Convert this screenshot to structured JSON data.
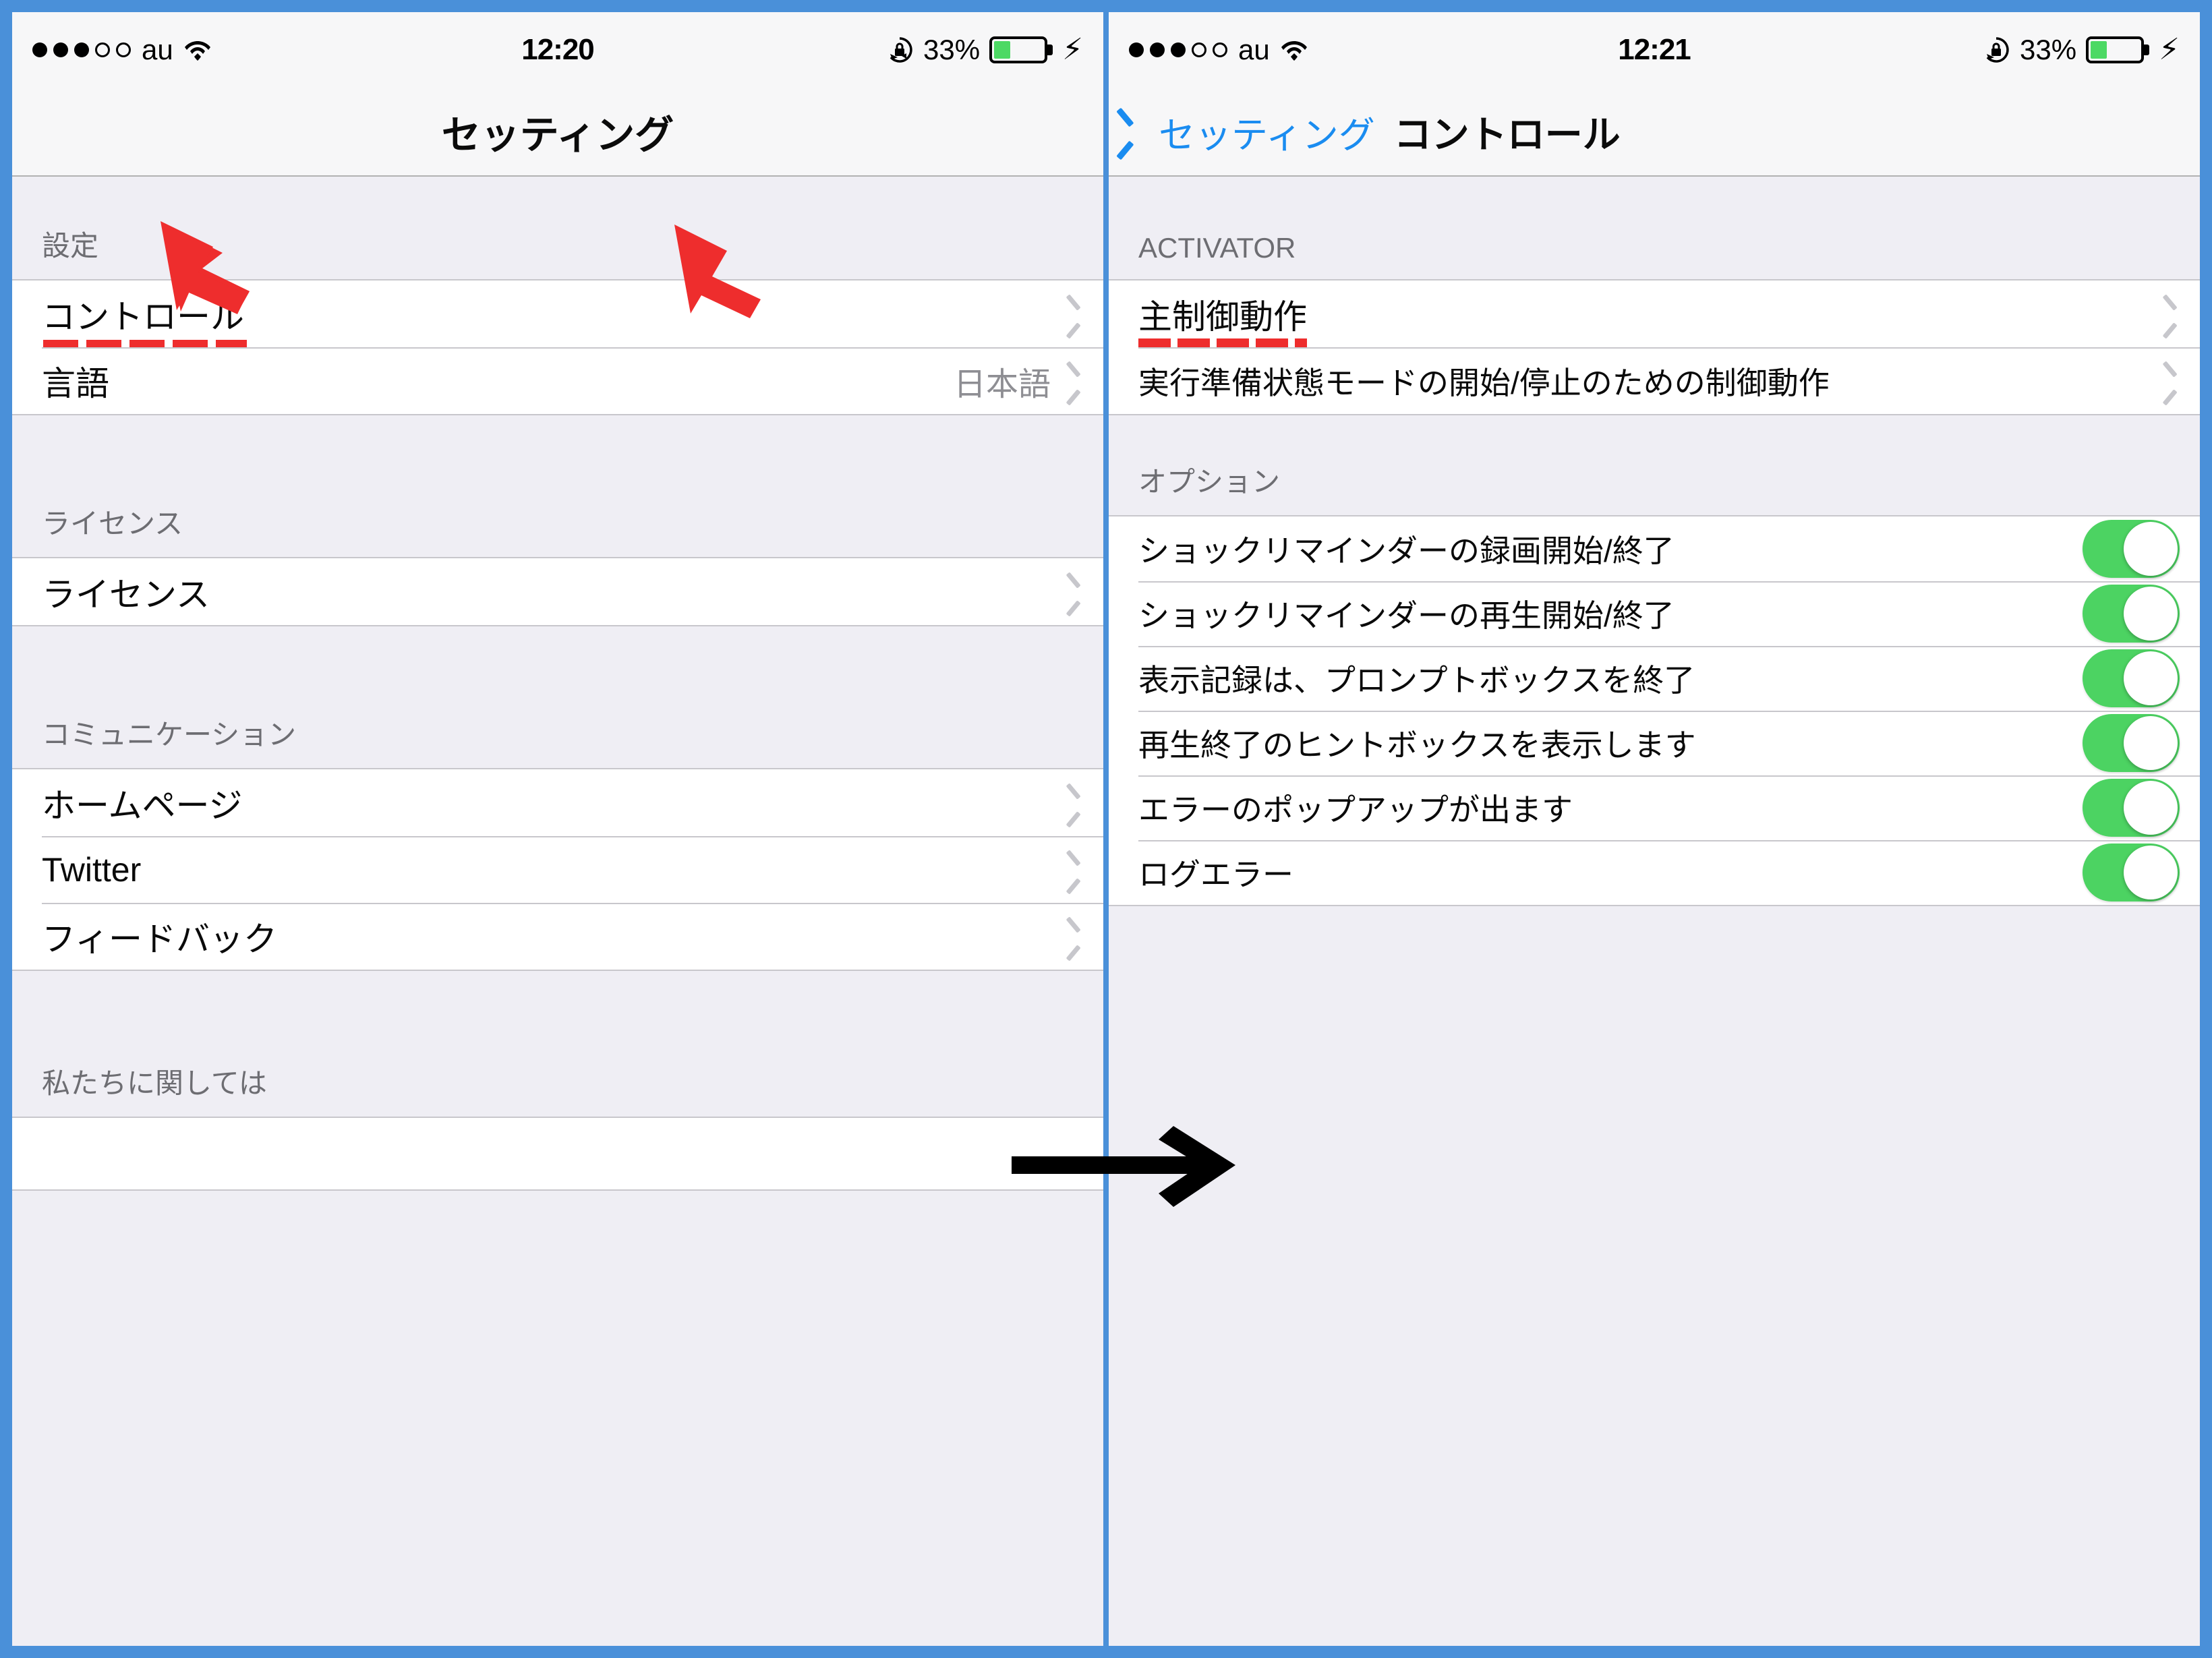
{
  "colors": {
    "frame_blue": "#4a90d9",
    "accent_blue": "#1a8cf0",
    "toggle_green": "#4cd362",
    "battery_green": "#4cd964",
    "section_bg": "#efeef4",
    "separator": "#c8c7cc",
    "annotation_red": "#ee2d2d",
    "annotation_black": "#000000"
  },
  "left_panel": {
    "status_bar": {
      "signal_dots_filled": 3,
      "signal_dots_total": 5,
      "carrier": "au",
      "wifi_icon": "wifi-icon",
      "time": "12:20",
      "rotation_lock_icon": "rotation-lock-icon",
      "battery_percent": "33%",
      "battery_level": 33,
      "charging_icon": "lightning-bolt-icon"
    },
    "nav": {
      "title": "セッティング"
    },
    "sections": [
      {
        "header": "設定",
        "rows": [
          {
            "label": "コントロール",
            "value": "",
            "accessory": "chevron-right-icon",
            "highlighted": true
          },
          {
            "label": "言語",
            "value": "日本語",
            "accessory": "chevron-right-icon",
            "highlighted": false
          }
        ]
      },
      {
        "header": "ライセンス",
        "rows": [
          {
            "label": "ライセンス",
            "value": "",
            "accessory": "chevron-right-icon",
            "highlighted": false
          }
        ]
      },
      {
        "header": "コミュニケーション",
        "rows": [
          {
            "label": "ホームページ",
            "value": "",
            "accessory": "chevron-right-icon",
            "highlighted": false
          },
          {
            "label": "Twitter",
            "value": "",
            "accessory": "chevron-right-icon",
            "highlighted": false
          },
          {
            "label": "フィードバック",
            "value": "",
            "accessory": "chevron-right-icon",
            "highlighted": false
          }
        ]
      },
      {
        "header": "私たちに関しては",
        "rows": []
      }
    ]
  },
  "right_panel": {
    "status_bar": {
      "signal_dots_filled": 3,
      "signal_dots_total": 5,
      "carrier": "au",
      "wifi_icon": "wifi-icon",
      "time": "12:21",
      "rotation_lock_icon": "rotation-lock-icon",
      "battery_percent": "33%",
      "battery_level": 33,
      "charging_icon": "lightning-bolt-icon"
    },
    "nav": {
      "back_icon": "chevron-left-icon",
      "back_label": "セッティング",
      "title": "コントロール"
    },
    "sections": [
      {
        "header": "ACTIVATOR",
        "rows": [
          {
            "label": "主制御動作",
            "accessory": "chevron-right-icon",
            "highlighted": true
          },
          {
            "label": "実行準備状態モードの開始/停止のための制御動作",
            "accessory": "chevron-right-icon",
            "highlighted": false
          }
        ]
      },
      {
        "header": "オプション",
        "rows": [
          {
            "label": "ショックリマインダーの録画開始/終了",
            "accessory": "toggle",
            "toggle_on": true
          },
          {
            "label": "ショックリマインダーの再生開始/終了",
            "accessory": "toggle",
            "toggle_on": true
          },
          {
            "label": "表示記録は、プロンプトボックスを終了",
            "accessory": "toggle",
            "toggle_on": true
          },
          {
            "label": "再生終了のヒントボックスを表示します",
            "accessory": "toggle",
            "toggle_on": true
          },
          {
            "label": "エラーのポップアップが出ます",
            "accessory": "toggle",
            "toggle_on": true
          },
          {
            "label": "ログエラー",
            "accessory": "toggle",
            "toggle_on": true
          }
        ]
      }
    ]
  },
  "annotations": [
    {
      "name": "red-arrow-left",
      "color": "#ee2d2d",
      "points_to": "コントロール"
    },
    {
      "name": "red-arrow-right",
      "color": "#ee2d2d",
      "points_to": "主制御動作"
    },
    {
      "name": "black-arrow-flow",
      "color": "#000000",
      "points_to": "right-panel"
    }
  ]
}
